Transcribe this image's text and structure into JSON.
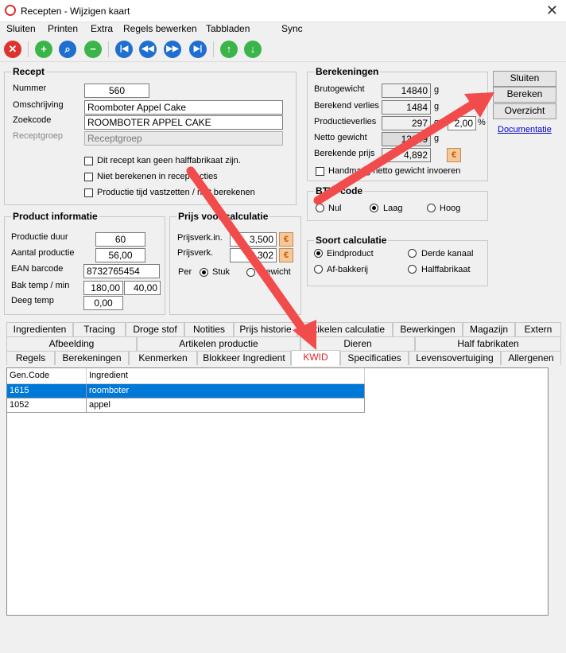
{
  "window": {
    "title": "Recepten - Wijzigen kaart",
    "close_glyph": "✕"
  },
  "menu": [
    "Sluiten",
    "Printen",
    "Extra",
    "Regels bewerken",
    "Tabbladen",
    "Sync"
  ],
  "recept": {
    "legend": "Recept",
    "nummer_label": "Nummer",
    "nummer": "560",
    "omschrijving_label": "Omschrijving",
    "omschrijving": "Roomboter Appel Cake",
    "zoekcode_label": "Zoekcode",
    "zoekcode": "ROOMBOTER APPEL CAKE",
    "receptgroep_label": "Receptgroep",
    "receptgroep_placeholder": "Receptgroep",
    "check1": "Dit recept kan geen halffabrikaat zijn.",
    "check2": "Niet berekenen in recept acties",
    "check3": "Productie tijd vastzetten / niet berekenen"
  },
  "berekeningen": {
    "legend": "Berekeningen",
    "bruto_label": "Brutogewicht",
    "bruto": "14840",
    "verlies_label": "Berekend verlies",
    "verlies": "1484",
    "prodverlies_label": "Productieverlies",
    "prodverlies": "297",
    "prodverlies_pct": "2,00",
    "netto_label": "Netto gewicht",
    "netto": "13059",
    "prijs_label": "Berekende prijs",
    "prijs": "4,892",
    "handmatig": "Handmatig netto gewicht invoeren",
    "unit_g": "g",
    "unit_pct": "%"
  },
  "buttons": {
    "sluiten": "Sluiten",
    "bereken": "Bereken",
    "overzicht": "Overzicht",
    "documentatie": "Documentatie"
  },
  "btw": {
    "legend": "BTW-code",
    "nul": "Nul",
    "laag": "Laag",
    "hoog": "Hoog",
    "selected": "laag"
  },
  "product": {
    "legend": "Product informatie",
    "duur_label": "Productie duur",
    "duur": "60",
    "aantal_label": "Aantal productie",
    "aantal": "56,00",
    "ean_label": "EAN barcode",
    "ean": "8732765454",
    "bak_label": "Bak temp / min",
    "bak_temp": "180,00",
    "bak_min": "40,00",
    "deeg_label": "Deeg temp",
    "deeg": "0,00"
  },
  "prijs": {
    "legend": "Prijs voor calculatie",
    "verkin_label": "Prijsverk.in.",
    "verkin": "3,500",
    "verkex_label": "Prijsverk.",
    "verkex": "3,302",
    "per_label": "Per",
    "stuk": "Stuk",
    "gewicht": "Gewicht"
  },
  "soort": {
    "legend": "Soort calculatie",
    "eindproduct": "Eindproduct",
    "derde": "Derde kanaal",
    "afbakkerij": "Af-bakkerij",
    "halffabrikaat": "Halffabrikaat"
  },
  "tabs": {
    "row1": [
      "Ingredienten",
      "Tracing",
      "Droge stof",
      "Notities",
      "Prijs historie",
      "Artikelen calculatie",
      "Bewerkingen",
      "Magazijn",
      "Extern"
    ],
    "row2": [
      "Afbeelding",
      "Artikelen productie",
      "Dieren",
      "Half fabrikaten"
    ],
    "row3": [
      "Regels",
      "Berekeningen",
      "Kenmerken",
      "Blokkeer Ingredient",
      "KWID",
      "Specificaties",
      "Levensovertuiging",
      "Allergenen"
    ]
  },
  "grid": {
    "headers": [
      "Gen.Code",
      "Ingredient"
    ],
    "rows": [
      [
        "1615",
        "roomboter"
      ],
      [
        "1052",
        "appel"
      ]
    ]
  },
  "colors": {
    "accent_red": "#e32222",
    "selection": "#0078d7",
    "arrow": "#f24b4b"
  }
}
